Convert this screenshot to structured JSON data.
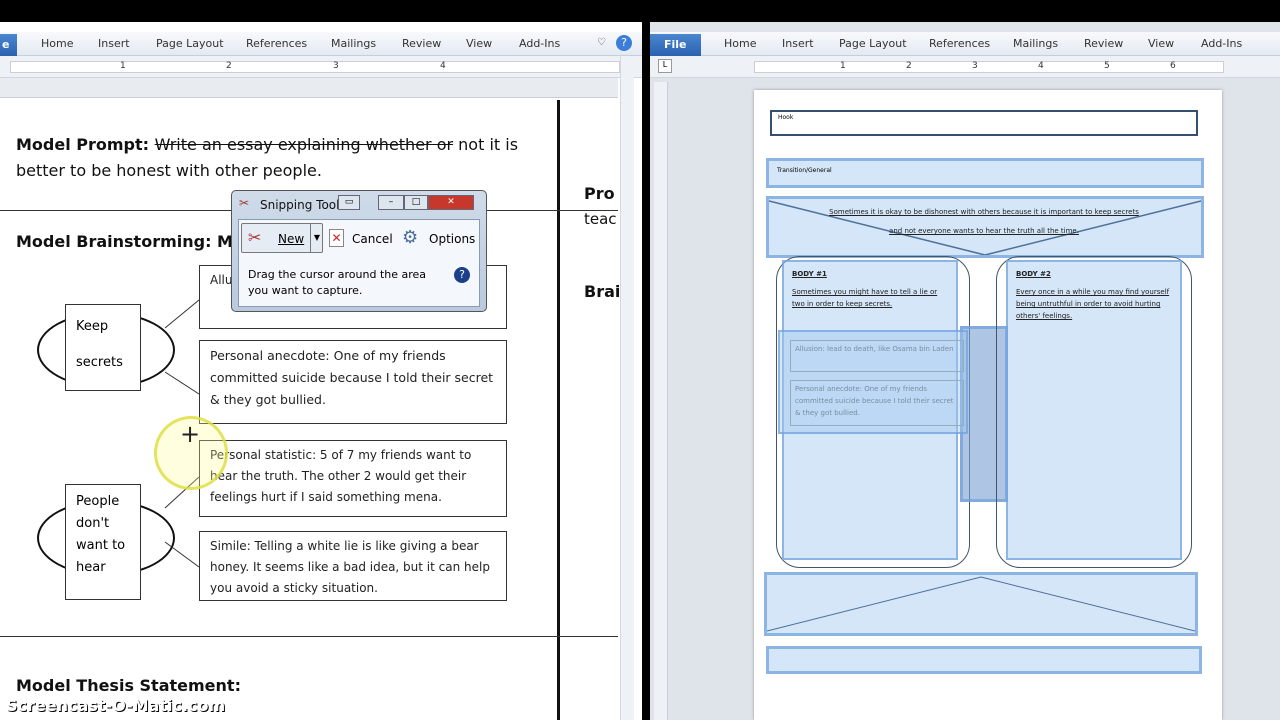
{
  "left_window": {
    "ribbon_tabs": [
      "Home",
      "Insert",
      "Page Layout",
      "References",
      "Mailings",
      "Review",
      "View",
      "Add-Ins"
    ],
    "file_tab": "e",
    "ruler_numbers": [
      "1",
      "2",
      "3",
      "4"
    ],
    "prompt_label": "Model Prompt: ",
    "prompt_struck": "Write an essay explaining whether or",
    "prompt_rest": " not it is better to be honest with other people.",
    "brainstorm_heading": "Model Brainstorming: MU",
    "ovals": [
      {
        "text": "Keep secrets"
      },
      {
        "text": "People don't want to hear"
      }
    ],
    "boxes": [
      "Allu",
      "Personal anecdote: One of my friends committed suicide because I told their secret & they got bullied.",
      "Personal statistic: 5 of 7 my friends want to hear the truth. The other 2 would get their feelings hurt if I said something mena.",
      "Simile: Telling a white lie is like giving a bear honey. It seems like a bad idea, but it can help you avoid a sticky situation."
    ],
    "right_col_text": [
      "Pro",
      "teac",
      "Brai"
    ],
    "thesis_heading": "Model Thesis Statement:"
  },
  "snipping_tool": {
    "title": "Snipping Tool",
    "new_label": "New",
    "cancel_label": "Cancel",
    "options_label": "Options",
    "instruction": "Drag the cursor around the area you want to capture."
  },
  "right_window": {
    "file_tab": "File",
    "ribbon_tabs": [
      "Home",
      "Insert",
      "Page Layout",
      "References",
      "Mailings",
      "Review",
      "View",
      "Add-Ins"
    ],
    "ruler_numbers": [
      "1",
      "2",
      "3",
      "4",
      "5",
      "6"
    ],
    "hook": "Hook",
    "transition": "Transition/General",
    "thesis": "Sometimes it is okay to be dishonest with others because it is important to keep secrets and not everyone wants to hear the truth all the time.",
    "body1_title": "BODY #1",
    "body1_text": "Sometimes you might have to tell a lie or two in order to keep secrets.",
    "body1_allusion": "Allusion: lead to death, like Osama bin Laden",
    "body1_anecdote": "Personal anecdote: One of my friends committed suicide because I told their secret & they got bullied.",
    "body2_title": "BODY #2",
    "body2_text": "Every once in a while you may find yourself being untruthful in order to avoid hurting others' feelings."
  },
  "watermark": "Screencast-O-Matic.com"
}
